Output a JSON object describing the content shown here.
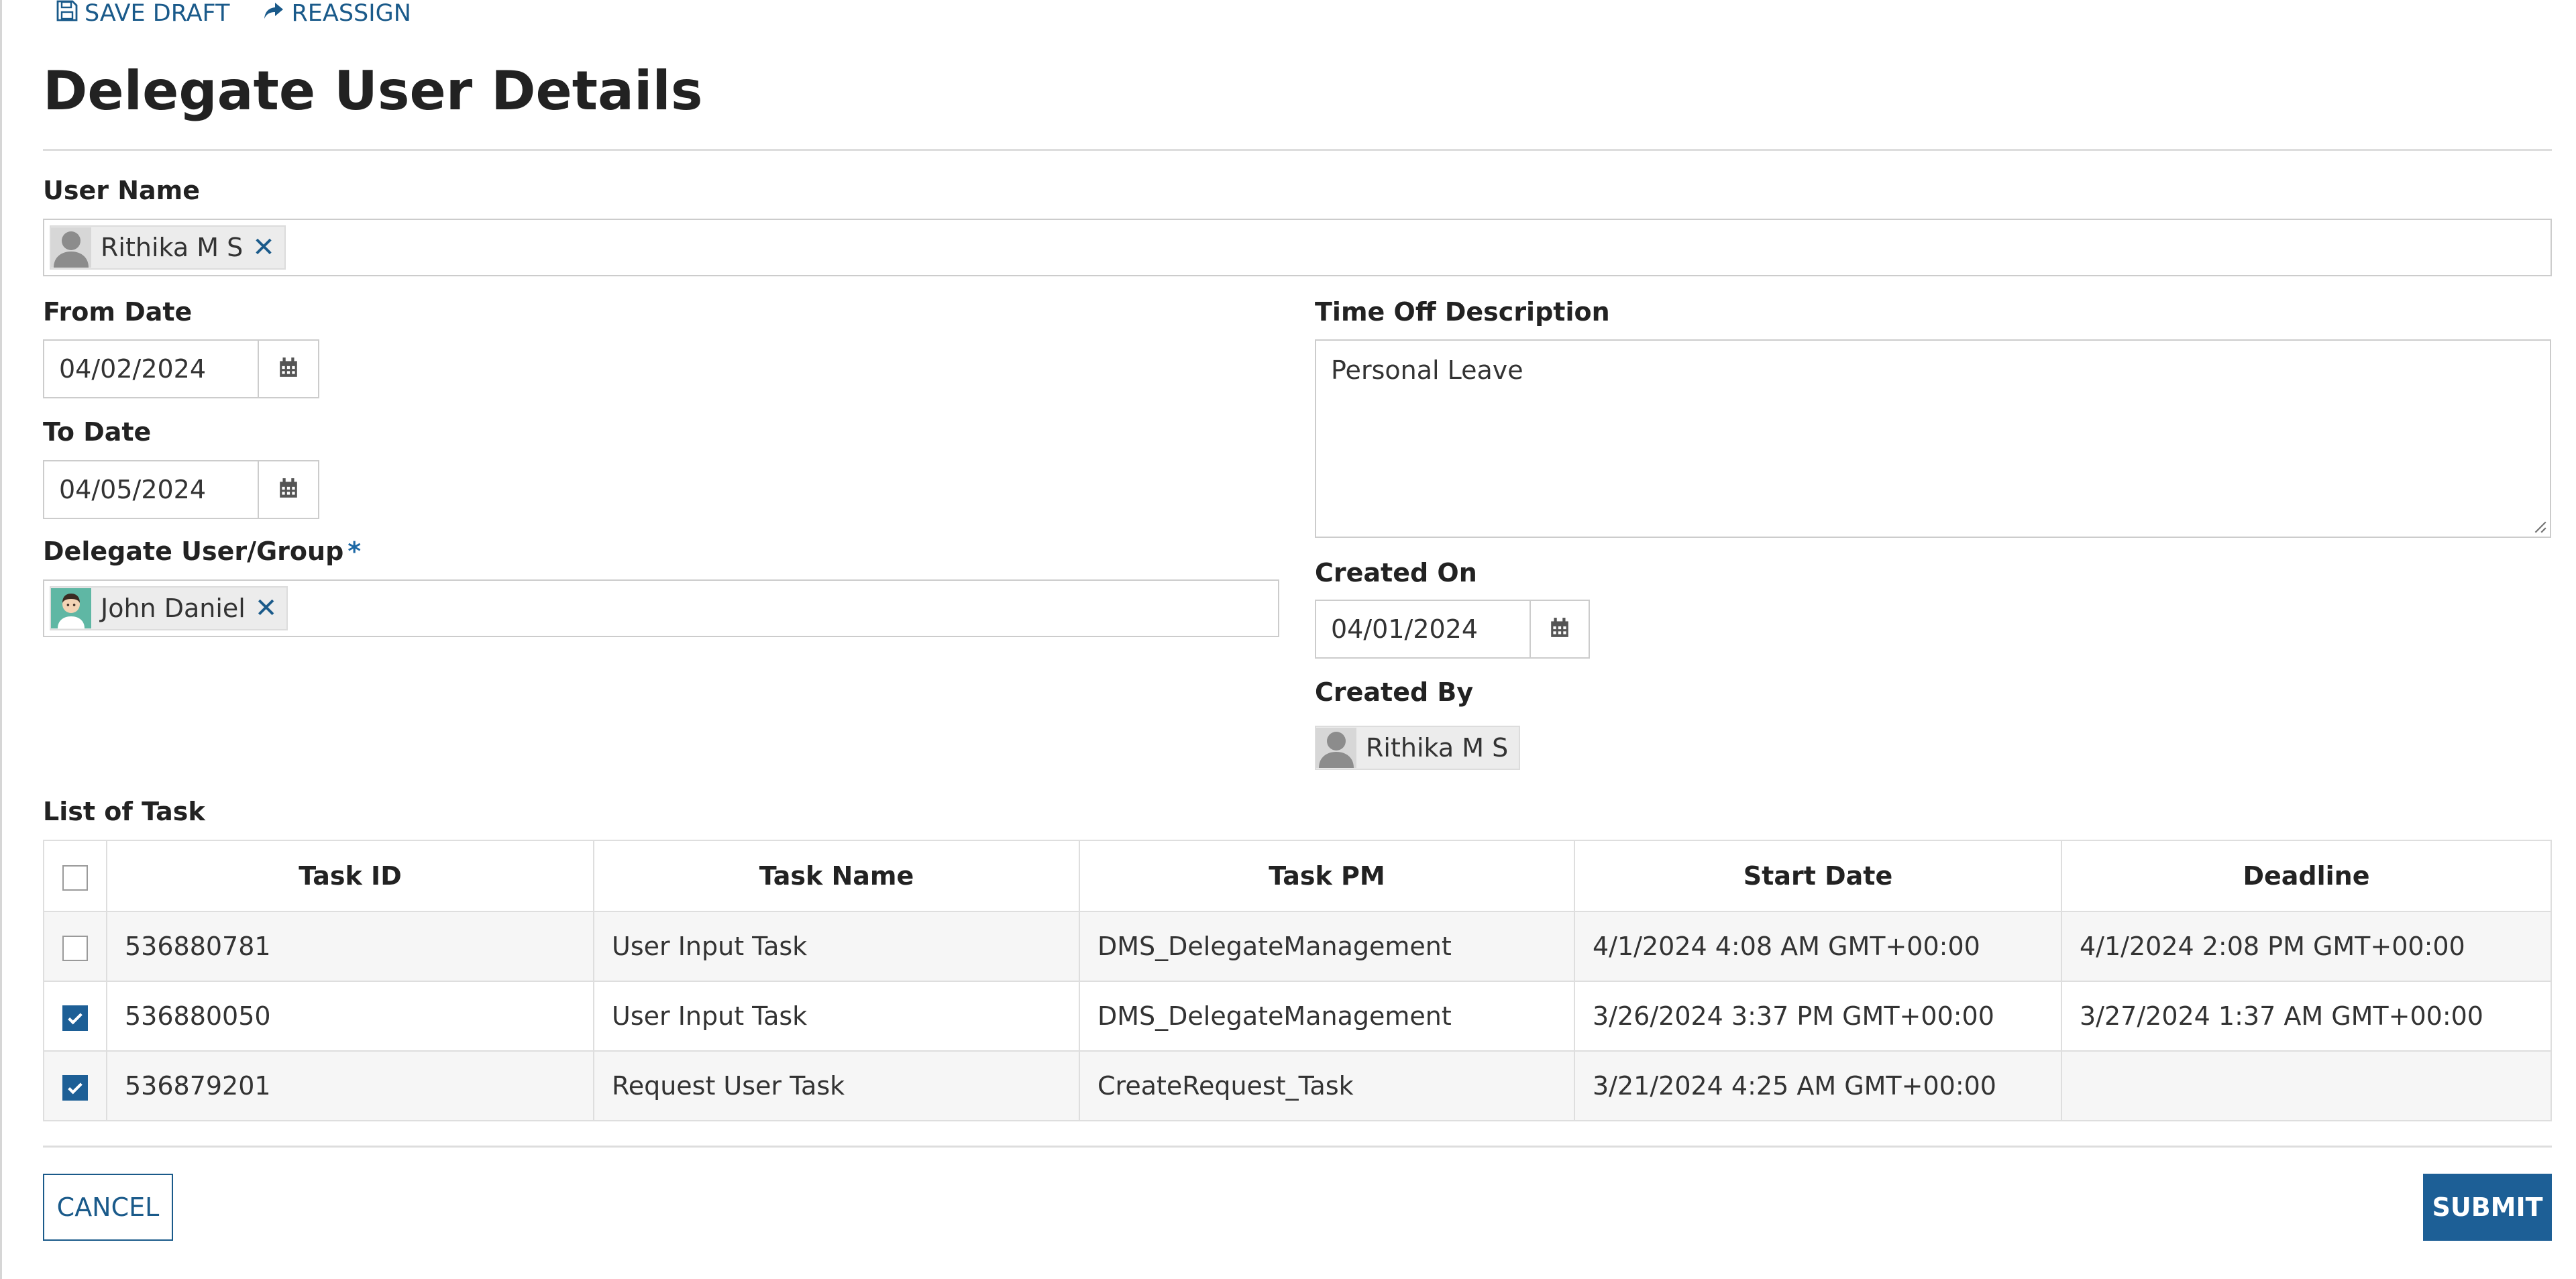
{
  "toolbar": {
    "save_draft": "SAVE DRAFT",
    "reassign": "REASSIGN"
  },
  "page": {
    "title": "Delegate User Details"
  },
  "user_name": {
    "label": "User Name",
    "chip": {
      "name": "Rithika M S",
      "remove": "✕"
    }
  },
  "from_date": {
    "label": "From Date",
    "value": "04/02/2024"
  },
  "to_date": {
    "label": "To Date",
    "value": "04/05/2024"
  },
  "delegate": {
    "label": "Delegate User/Group",
    "required_mark": "*",
    "chip": {
      "name": "John Daniel",
      "remove": "✕"
    }
  },
  "time_off": {
    "label": "Time Off Description",
    "value": "Personal Leave"
  },
  "created_on": {
    "label": "Created On",
    "value": "04/01/2024"
  },
  "created_by": {
    "label": "Created By",
    "chip": {
      "name": "Rithika M S"
    }
  },
  "tasks": {
    "label": "List of Task",
    "columns": [
      "Task ID",
      "Task Name",
      "Task PM",
      "Start Date",
      "Deadline"
    ],
    "rows": [
      {
        "checked": false,
        "task_id": "536880781",
        "task_name": "User Input Task",
        "task_pm": "DMS_DelegateManagement",
        "start_date": "4/1/2024 4:08 AM GMT+00:00",
        "deadline": "4/1/2024 2:08 PM GMT+00:00"
      },
      {
        "checked": true,
        "task_id": "536880050",
        "task_name": "User Input Task",
        "task_pm": "DMS_DelegateManagement",
        "start_date": "3/26/2024 3:37 PM GMT+00:00",
        "deadline": "3/27/2024 1:37 AM GMT+00:00"
      },
      {
        "checked": true,
        "task_id": "536879201",
        "task_name": "Request User Task",
        "task_pm": "CreateRequest_Task",
        "start_date": "3/21/2024 4:25 AM GMT+00:00",
        "deadline": ""
      }
    ]
  },
  "actions": {
    "cancel": "CANCEL",
    "submit": "SUBMIT"
  },
  "icons": {
    "save": "floppy-disk-icon",
    "reassign": "share-arrow-icon",
    "calendar": "calendar-icon",
    "remove": "close-icon",
    "checkbox": "checkmark-icon"
  },
  "colors": {
    "accent": "#1d5f96",
    "link": "#1a5a8a"
  }
}
